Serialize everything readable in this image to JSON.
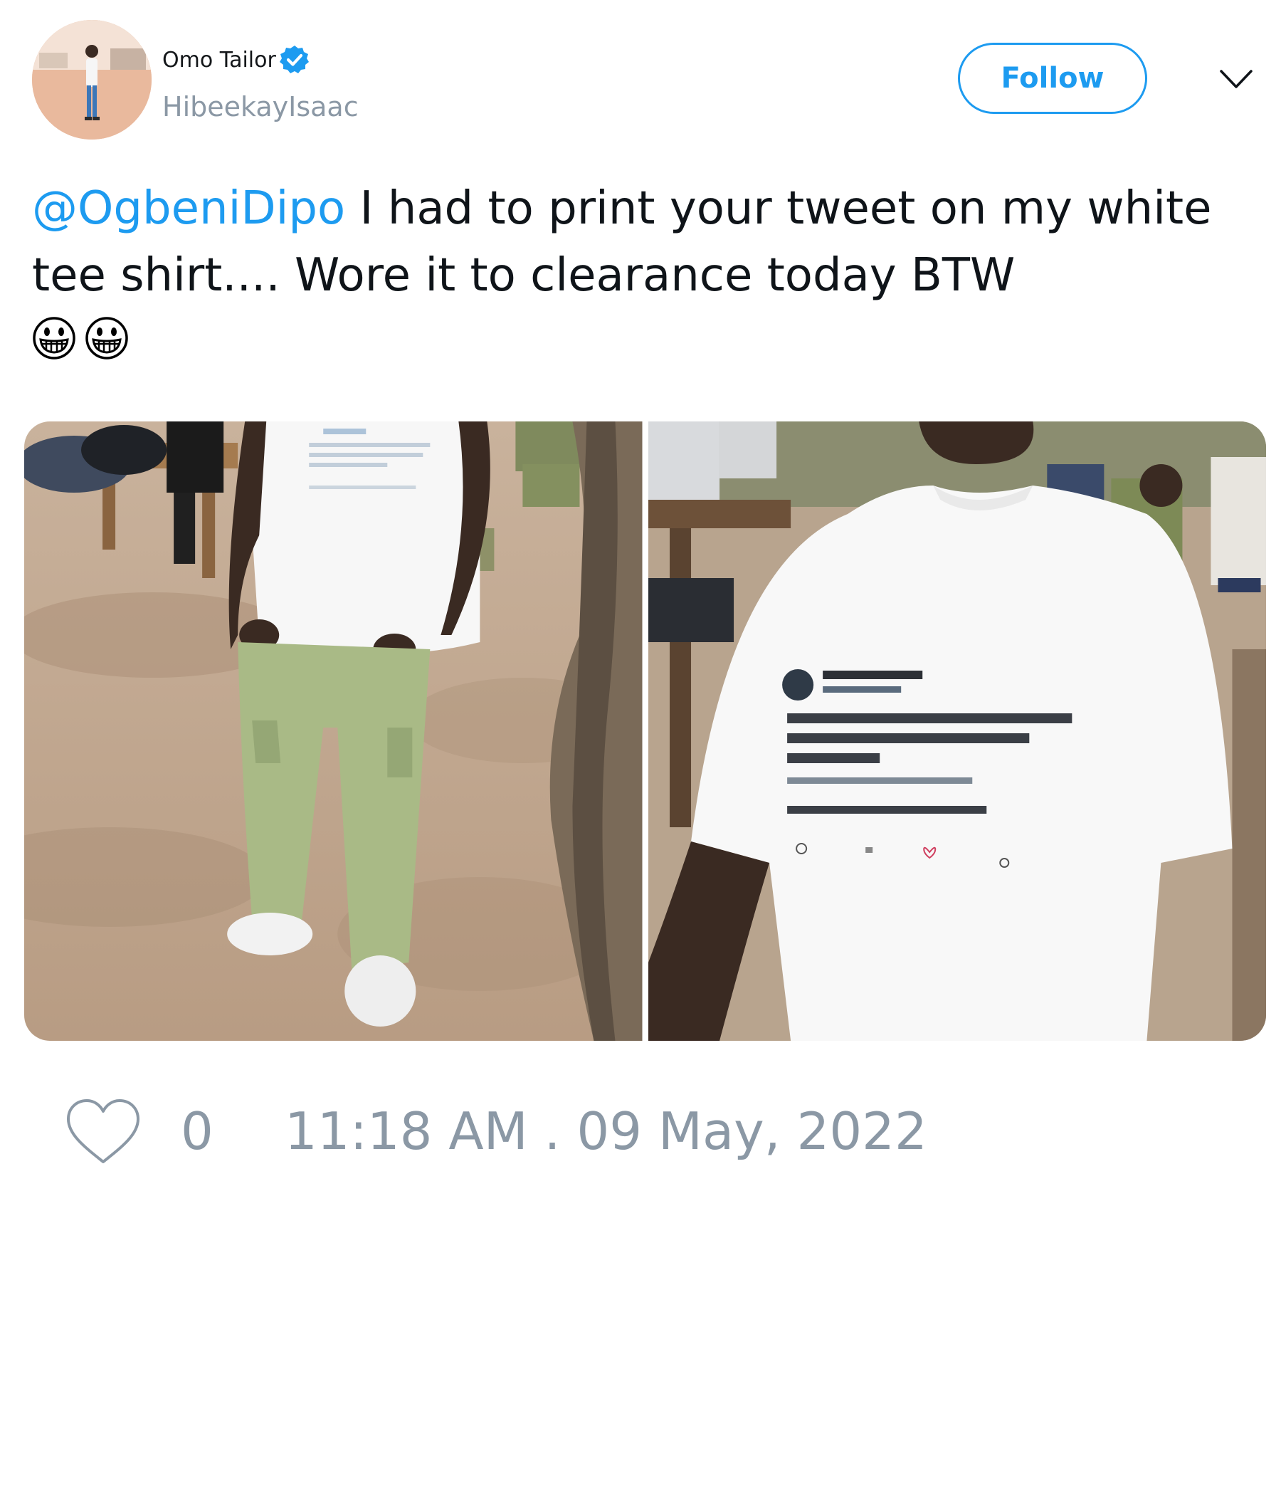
{
  "author": {
    "display_name": "Omo Tailor",
    "handle": "HibeekayIsaac",
    "verified": true,
    "avatar_icon": "user-avatar"
  },
  "actions": {
    "follow_label": "Follow",
    "more_icon": "chevron-down-icon"
  },
  "tweet": {
    "mention": "@OgbeniDipo",
    "text": " I had to print your tweet on my white tee shirt.... Wore it to clearance today BTW",
    "emojis": [
      "grinning-face-emoji",
      "grinning-face-emoji"
    ]
  },
  "media": [
    {
      "icon": "photo-full-body"
    },
    {
      "icon": "photo-tshirt-closeup"
    }
  ],
  "footer": {
    "like_icon": "heart-icon",
    "like_count": "0",
    "timestamp": "11:18 AM . 09 May, 2022"
  },
  "colors": {
    "accent": "#1d9bf0",
    "muted": "#8b98a5",
    "text": "#0f1419"
  }
}
